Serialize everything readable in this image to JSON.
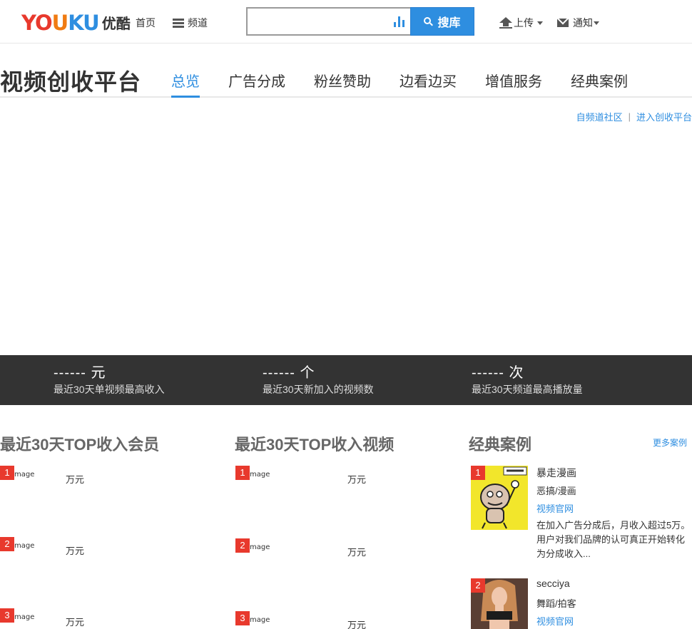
{
  "header": {
    "logo_parts": [
      "YO",
      "U",
      "KU"
    ],
    "logo_cn": "优酷",
    "home": "首页",
    "channel": "频道",
    "search_placeholder": "",
    "search_button": "搜库",
    "upload": "上传",
    "notice": "通知"
  },
  "platform": {
    "title": "视频创收平台",
    "tabs": [
      "总览",
      "广告分成",
      "粉丝赞助",
      "边看边买",
      "增值服务",
      "经典案例"
    ],
    "active_tab": "总览",
    "link_community": "自频道社区",
    "link_separator": "|",
    "link_enter": "进入创收平台"
  },
  "stats": [
    {
      "value": "------ 元",
      "label": "最近30天单视频最高收入"
    },
    {
      "value": "------ 个",
      "label": "最近30天新加入的视频数"
    },
    {
      "value": "------ 次",
      "label": "最近30天频道最高播放量"
    }
  ],
  "members": {
    "title": "最近30天TOP收入会员",
    "items": [
      {
        "rank": "1",
        "alt": "mage",
        "amount": "万元"
      },
      {
        "rank": "2",
        "alt": "mage",
        "amount": "万元"
      },
      {
        "rank": "3",
        "alt": "mage",
        "amount": "万元"
      }
    ]
  },
  "videos": {
    "title": "最近30天TOP收入视频",
    "items": [
      {
        "rank": "1",
        "alt": "mage",
        "amount": "万元"
      },
      {
        "rank": "2",
        "alt": "mage",
        "amount": "万元"
      },
      {
        "rank": "3",
        "alt": "mage",
        "amount": "万元"
      }
    ]
  },
  "cases": {
    "title": "经典案例",
    "more": "更多案例",
    "items": [
      {
        "rank": "1",
        "name": "暴走漫画",
        "category": "恶搞/漫画",
        "link": "视频官网",
        "description": "在加入广告分成后，月收入超过5万。用户对我们品牌的认可真正开始转化为分成收入..."
      },
      {
        "rank": "2",
        "name": "secciya",
        "category": "舞蹈/拍客",
        "link": "视频官网"
      }
    ]
  },
  "colors": {
    "brand_blue": "#2e8ee0",
    "rank_red": "#e8392d",
    "stats_band": "#333333"
  }
}
